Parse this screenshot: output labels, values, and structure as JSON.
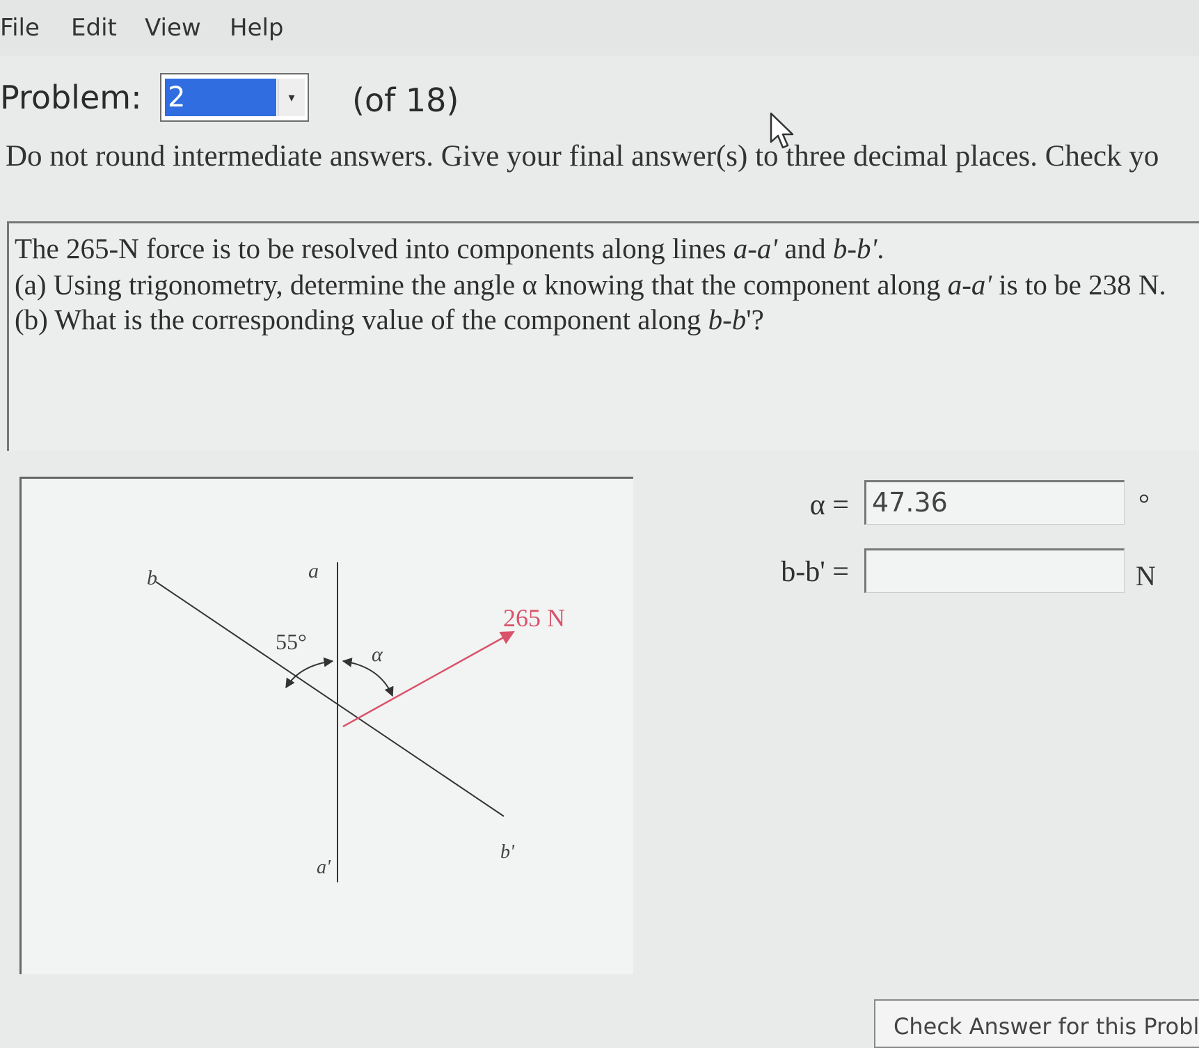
{
  "menu": {
    "file": "File",
    "edit": "Edit",
    "view": "View",
    "help": "Help"
  },
  "problem": {
    "label": "Problem:",
    "selected": "2",
    "of_total": "(of 18)"
  },
  "instructions": "Do not round intermediate answers.  Give your final answer(s) to three decimal places.  Check yo",
  "question": {
    "line1_pre": "The 265-N force is to be resolved into components along lines ",
    "line1_aa": "a-a'",
    "line1_mid": " and ",
    "line1_bb": "b-b'",
    "line1_end": ".",
    "line2_pre": "(a) Using trigonometry, determine the angle α knowing that the component along ",
    "line2_aa": "a-a'",
    "line2_end": " is to be 238 N.",
    "line3_pre": "(b) What is the corresponding value of the component along ",
    "line3_bb": "b-b",
    "line3_end": "'?"
  },
  "figure": {
    "label_b": "b",
    "label_a": "a",
    "label_a_prime": "a'",
    "label_b_prime": "b'",
    "angle_55": "55°",
    "angle_alpha": "α",
    "force": "265 N",
    "force_color": "#d9536a",
    "line_color": "#333333"
  },
  "answers": {
    "alpha_label": "α =",
    "alpha_value": "47.36",
    "alpha_unit": "°",
    "bb_label": "b-b' =",
    "bb_value": "",
    "bb_unit": "N"
  },
  "check_button": "Check Answer for this Problem"
}
